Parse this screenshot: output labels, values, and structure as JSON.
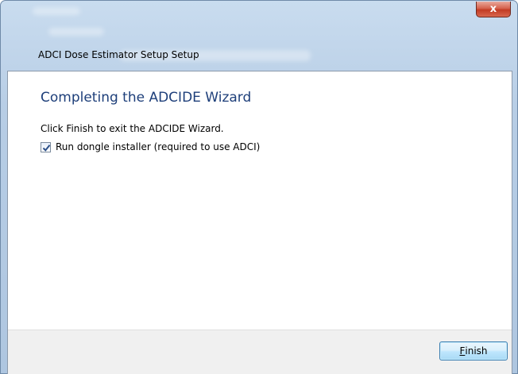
{
  "window": {
    "title": "ADCI Dose Estimator Setup Setup",
    "close_glyph": "x"
  },
  "wizard": {
    "heading": "Completing the ADCIDE Wizard",
    "instruction": "Click Finish to exit the ADCIDE Wizard.",
    "checkbox_label": "Run dongle installer (required to use ADCI)",
    "checkbox_checked": true
  },
  "footer": {
    "finish_mnemonic": "F",
    "finish_rest": "inish"
  },
  "colors": {
    "heading": "#1e3f7a",
    "close_button": "#c23b23",
    "default_button_border": "#3c7fb1"
  }
}
